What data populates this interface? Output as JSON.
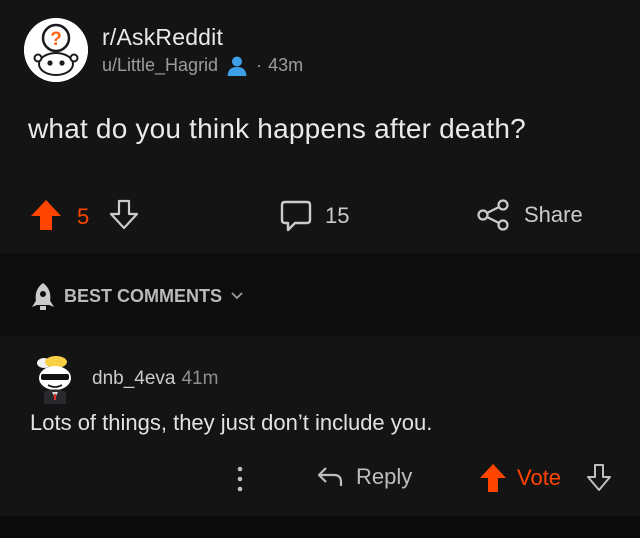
{
  "post": {
    "subreddit": "r/AskReddit",
    "author": "u/Little_Hagrid",
    "separator": "·",
    "age": "43m",
    "title": "what do you think happens after death?",
    "score": "5",
    "comment_count": "15",
    "share_label": "Share"
  },
  "sort": {
    "label": "BEST COMMENTS"
  },
  "comment": {
    "author": "dnb_4eva",
    "age": "41m",
    "body": "Lots of things, they just don’t include you.",
    "reply_label": "Reply",
    "vote_label": "Vote"
  },
  "colors": {
    "upvote": "#ff4500",
    "background": "#141415",
    "text": "#d7dadc"
  }
}
